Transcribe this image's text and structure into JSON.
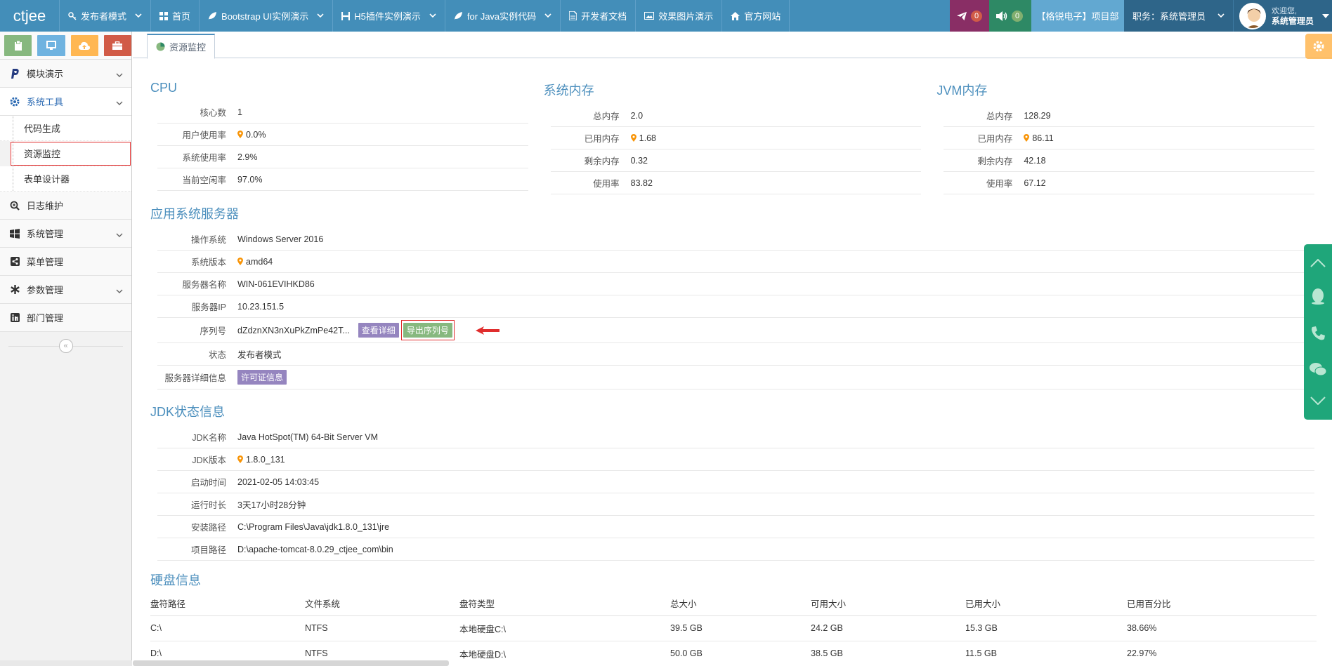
{
  "topbar": {
    "brand": "ctjee",
    "nav": [
      {
        "label": "发布者模式",
        "icon": "key-icon",
        "dropdown": true
      },
      {
        "label": "首页",
        "icon": "grid-icon",
        "dropdown": false
      },
      {
        "label": "Bootstrap UI实例演示",
        "icon": "leaf-icon",
        "dropdown": true
      },
      {
        "label": "H5插件实例演示",
        "icon": "h-icon",
        "dropdown": true
      },
      {
        "label": "for Java实例代码",
        "icon": "leaf-icon",
        "dropdown": true
      },
      {
        "label": "开发者文档",
        "icon": "document-icon",
        "dropdown": false
      },
      {
        "label": "效果图片演示",
        "icon": "picture-icon",
        "dropdown": false
      },
      {
        "label": "官方网站",
        "icon": "home-icon",
        "dropdown": false
      }
    ],
    "notify_count": "0",
    "volume_count": "0",
    "project_label": "【格锐电子】项目部",
    "role_label": "职务：系统管理员",
    "welcome": "欢迎您,",
    "username": "系统管理员",
    "colors": {
      "bar": "#438eb9",
      "notify_bg": "#892e65",
      "volume_bg": "#2e8965",
      "project_bg": "#62a8d1",
      "role_bg": "#2e6589"
    }
  },
  "sidebar": {
    "shortcuts": [
      {
        "icon": "clipboard-icon",
        "color": "#87b87f"
      },
      {
        "icon": "monitor-icon",
        "color": "#6fb3e0"
      },
      {
        "icon": "cloud-upload-icon",
        "color": "#ffb752"
      },
      {
        "icon": "briefcase-icon",
        "color": "#d15b47"
      }
    ],
    "items": [
      {
        "label": "模块演示",
        "icon": "paypal-icon",
        "has_arrow": true
      },
      {
        "label": "系统工具",
        "icon": "cog-icon",
        "has_arrow": true,
        "open": true,
        "children": [
          "代码生成",
          "资源监控",
          "表单设计器"
        ],
        "active_child": 1
      },
      {
        "label": "日志维护",
        "icon": "search-plus-icon",
        "has_arrow": false
      },
      {
        "label": "系统管理",
        "icon": "windows-icon",
        "has_arrow": true
      },
      {
        "label": "菜单管理",
        "icon": "share-icon",
        "has_arrow": false
      },
      {
        "label": "参数管理",
        "icon": "asterisk-icon",
        "has_arrow": true
      },
      {
        "label": "部门管理",
        "icon": "linkedin-icon",
        "has_arrow": false
      }
    ]
  },
  "tab": {
    "label": "资源监控",
    "icon": "pie-chart-icon"
  },
  "cpu": {
    "title": "CPU",
    "rows": [
      {
        "k": "核心数",
        "v": "1",
        "pin": false
      },
      {
        "k": "用户使用率",
        "v": "0.0%",
        "pin": true
      },
      {
        "k": "系统使用率",
        "v": "2.9%",
        "pin": false
      },
      {
        "k": "当前空闲率",
        "v": "97.0%",
        "pin": false
      }
    ]
  },
  "mem": {
    "title": "系统内存",
    "rows": [
      {
        "k": "总内存",
        "v": "2.0",
        "pin": false
      },
      {
        "k": "已用内存",
        "v": "1.68",
        "pin": true
      },
      {
        "k": "剩余内存",
        "v": "0.32",
        "pin": false
      },
      {
        "k": "使用率",
        "v": "83.82",
        "pin": false
      }
    ]
  },
  "jvm": {
    "title": "JVM内存",
    "rows": [
      {
        "k": "总内存",
        "v": "128.29",
        "pin": false
      },
      {
        "k": "已用内存",
        "v": "86.11",
        "pin": true
      },
      {
        "k": "剩余内存",
        "v": "42.18",
        "pin": false
      },
      {
        "k": "使用率",
        "v": "67.12",
        "pin": false
      }
    ]
  },
  "server": {
    "title": "应用系统服务器",
    "os_k": "操作系统",
    "os_v": "Windows Server 2016",
    "arch_k": "系统版本",
    "arch_v": "amd64",
    "name_k": "服务器名称",
    "name_v": "WIN-061EVIHKD86",
    "ip_k": "服务器IP",
    "ip_v": "10.23.151.5",
    "serial_k": "序列号",
    "serial_v": "dZdznXN3nXuPkZmPe42T...",
    "view_detail": "查看详细",
    "export_serial": "导出序列号",
    "status_k": "状态",
    "status_v": "发布者模式",
    "detail_k": "服务器详细信息",
    "license_btn": "许可证信息"
  },
  "jdk": {
    "title": "JDK状态信息",
    "rows": [
      {
        "k": "JDK名称",
        "v": "Java HotSpot(TM) 64-Bit Server VM",
        "pin": false
      },
      {
        "k": "JDK版本",
        "v": "1.8.0_131",
        "pin": true
      },
      {
        "k": "启动时间",
        "v": "2021-02-05 14:03:45",
        "pin": false
      },
      {
        "k": "运行时长",
        "v": "3天17小时28分钟",
        "pin": false
      },
      {
        "k": "安装路径",
        "v": "C:\\Program Files\\Java\\jdk1.8.0_131\\jre",
        "pin": false
      },
      {
        "k": "项目路径",
        "v": "D:\\apache-tomcat-8.0.29_ctjee_com\\bin",
        "pin": false
      }
    ]
  },
  "disk": {
    "title": "硬盘信息",
    "headers": [
      "盘符路径",
      "文件系统",
      "盘符类型",
      "总大小",
      "可用大小",
      "已用大小",
      "已用百分比"
    ],
    "rows": [
      [
        "C:\\",
        "NTFS",
        "本地硬盘C:\\",
        "39.5 GB",
        "24.2 GB",
        "15.3 GB",
        "38.66%"
      ],
      [
        "D:\\",
        "NTFS",
        "本地硬盘D:\\",
        "50.0 GB",
        "38.5 GB",
        "11.5 GB",
        "22.97%"
      ]
    ]
  },
  "pin_color": "#f89406"
}
